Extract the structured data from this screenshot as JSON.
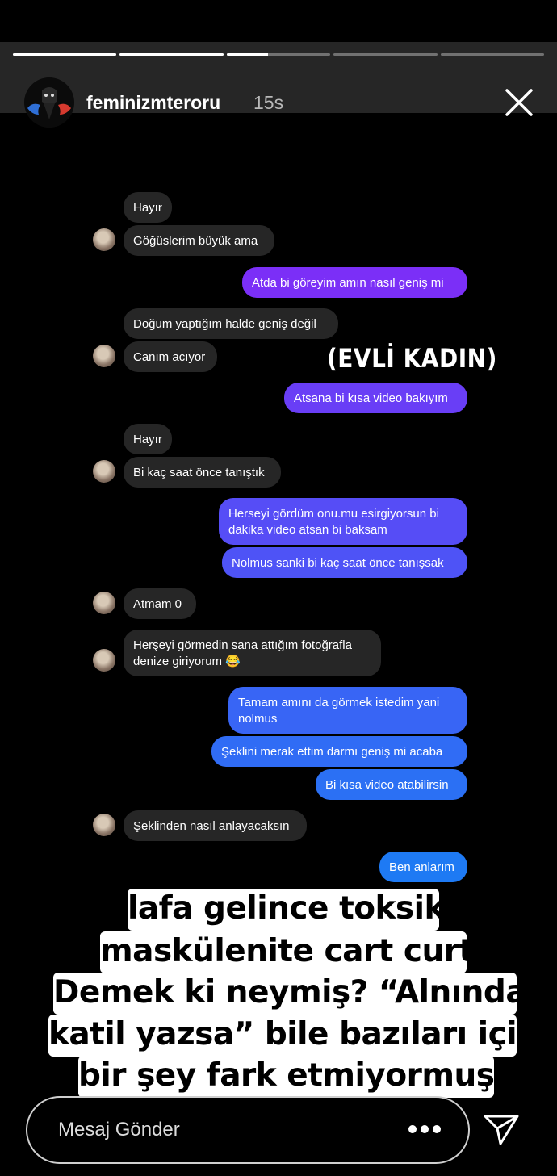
{
  "story": {
    "username": "feminizmteroru",
    "time": "15s",
    "progress": [
      1,
      1,
      0.4,
      0,
      0
    ]
  },
  "chat": {
    "messages": [
      {
        "dir": "in",
        "text": "Hayır"
      },
      {
        "dir": "in",
        "text": "Göğüslerim büyük ama"
      },
      {
        "dir": "out",
        "text": "Atda bi göreyim amın nasıl geniş mi"
      },
      {
        "dir": "in",
        "text": "Doğum yaptığım halde geniş değil"
      },
      {
        "dir": "in",
        "text": "Canım acıyor"
      },
      {
        "dir": "out",
        "text": "Atsana bi kısa video bakıyım"
      },
      {
        "dir": "in",
        "text": "Hayır"
      },
      {
        "dir": "in",
        "text": "Bi kaç saat önce tanıştık"
      },
      {
        "dir": "out",
        "text": "Herseyi gördüm onu.mu esirgiyorsun bi\ndakika video atsan bi baksam"
      },
      {
        "dir": "out",
        "text": "Nolmus sanki bi kaç saat önce tanışsak"
      },
      {
        "dir": "in",
        "text": "Atmam 0"
      },
      {
        "dir": "in",
        "text": "Herşeyi görmedin sana attığım fotoğrafla\ndenize giriyorum 😂"
      },
      {
        "dir": "out",
        "text": "Tamam amını da görmek istedim yani\nnolmus"
      },
      {
        "dir": "out",
        "text": "Şeklini merak ettim darmı geniş mi acaba"
      },
      {
        "dir": "out",
        "text": "Bi kısa video atabilirsin"
      },
      {
        "dir": "in",
        "text": "Şeklinden nasıl anlayacaksın"
      },
      {
        "dir": "out",
        "text": "Ben anlarım"
      }
    ],
    "annotation": "(EVLİ KADIN)"
  },
  "caption": {
    "lines": [
      "lafa gelince toksik",
      "maskülenite cart curt",
      "Demek ki neymiş? “Alnında",
      "katil yazsa” bile bazıları için",
      "bir şey fark etmiyormuş."
    ]
  },
  "footer": {
    "placeholder": "Mesaj Gönder"
  },
  "colors": {
    "incoming": "#262626",
    "outgoing_start": "#7b2ff7",
    "outgoing_end": "#1c7cf4"
  },
  "icons": [
    "avatar-icon",
    "close-icon",
    "more-icon",
    "send-icon"
  ]
}
